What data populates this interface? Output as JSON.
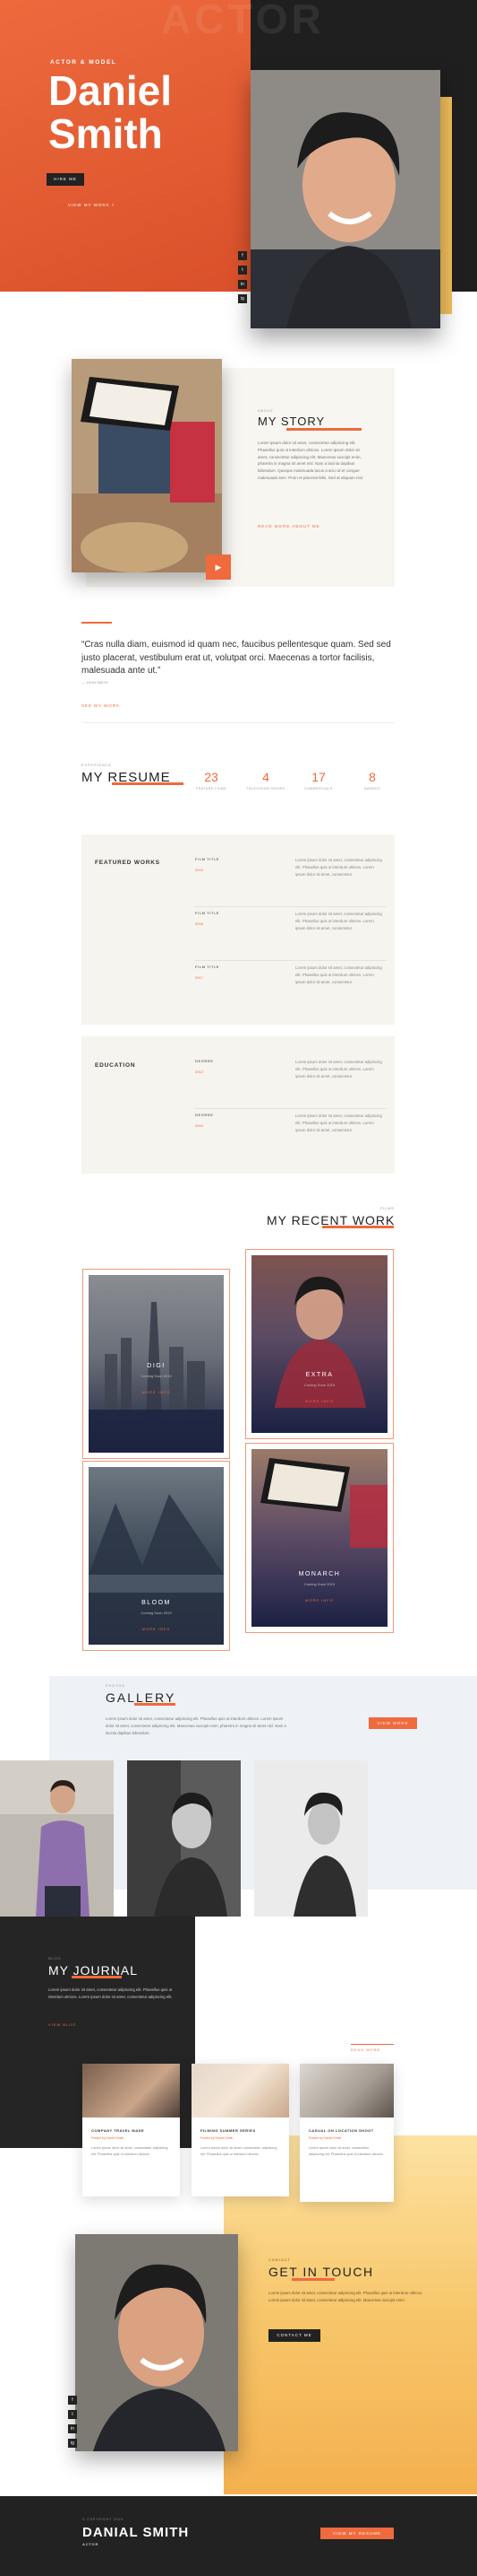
{
  "hero": {
    "bg_word": "ACTOR",
    "kicker": "ACTOR & MODEL",
    "name_line1": "Daniel",
    "name_line2": "Smith",
    "hire_btn": "HIRE ME",
    "about_link": "VIEW MY WORK",
    "socials": [
      "f",
      "t",
      "in",
      "ig"
    ],
    "colors": {
      "orange": "#ef6a3c",
      "dark": "#222222",
      "gold": "#f3c15a"
    }
  },
  "story": {
    "kicker": "ABOUT",
    "title": "MY STORY",
    "body": "Lorem ipsum dolor sit amet, consectetur adipiscing elit. Phasellus quis ut interdum ultrices. Lorem ipsum dolor sit amet, consectetur adipiscing elit. Maecenas suscipit enim, pharetra in magna sit amet nisl. Nam a lacinia dapibus bibendum. Quisque malesuada lacus a arcu id et congue malesuada sem. Proin et placerat felis. Sed at aliquam nisl.",
    "link": "READ MORE ABOUT ME",
    "play_icon": "play-icon"
  },
  "quote": {
    "text": "“Cras nulla diam, euismod id quam nec, faucibus pellentesque quam. Sed sed justo placerat, vestibulum erat ut, volutpat orci. Maecenas a tortor facilisis, malesuada ante ut.”",
    "author": "— JOHN SMITH",
    "link": "SEE MY WORK"
  },
  "resume": {
    "kicker": "EXPERIENCE",
    "title": "MY RESUME",
    "stats": [
      {
        "value": "23",
        "label": "FEATURE FILMS"
      },
      {
        "value": "4",
        "label": "TELEVISION SHOWS"
      },
      {
        "value": "17",
        "label": "COMMERCIALS"
      },
      {
        "value": "8",
        "label": "AWARDS"
      }
    ],
    "works": {
      "heading": "FEATURED WORKS",
      "rows": [
        {
          "title": "FILM TITLE",
          "year": "2019",
          "desc": "Lorem ipsum dolor sit amet, consectetur adipiscing elit. Phasellus quis ut interdum ultrices. Lorem ipsum dolor sit amet, consectetur."
        },
        {
          "title": "FILM TITLE",
          "year": "2018",
          "desc": "Lorem ipsum dolor sit amet, consectetur adipiscing elit. Phasellus quis ut interdum ultrices. Lorem ipsum dolor sit amet, consectetur."
        },
        {
          "title": "FILM TITLE",
          "year": "2017",
          "desc": "Lorem ipsum dolor sit amet, consectetur adipiscing elit. Phasellus quis ut interdum ultrices. Lorem ipsum dolor sit amet, consectetur."
        }
      ]
    },
    "education": {
      "heading": "EDUCATION",
      "rows": [
        {
          "title": "DEGREE",
          "year": "2012",
          "desc": "Lorem ipsum dolor sit amet, consectetur adipiscing elit. Phasellus quis ut interdum ultrices. Lorem ipsum dolor sit amet, consectetur."
        },
        {
          "title": "DEGREE",
          "year": "2010",
          "desc": "Lorem ipsum dolor sit amet, consectetur adipiscing elit. Phasellus quis ut interdum ultrices. Lorem ipsum dolor sit amet, consectetur."
        }
      ]
    }
  },
  "recent_work": {
    "kicker": "FILMS",
    "title": "MY RECENT WORK",
    "cards": [
      {
        "title": "DIGI",
        "meta": "Coming Soon 2019",
        "link": "MORE INFO"
      },
      {
        "title": "EXTRA",
        "meta": "Coming Soon 2019",
        "link": "MORE INFO"
      },
      {
        "title": "BLOOM",
        "meta": "Coming Soon 2019",
        "link": "MORE INFO"
      },
      {
        "title": "MONARCH",
        "meta": "Coming Soon 2019",
        "link": "MORE INFO"
      }
    ]
  },
  "gallery": {
    "kicker": "PHOTOS",
    "title": "GALLERY",
    "body": "Lorem ipsum dolor sit amet, consectetur adipiscing elit. Phasellus quis ut interdum ultrices. Lorem ipsum dolor sit amet, consectetur adipiscing elit. Maecenas suscipit enim, pharetra in magna sit amet nisl. Nam a lacinia dapibus bibendum.",
    "button": "VIEW MORE"
  },
  "journal": {
    "kicker": "BLOG",
    "title": "MY JOURNAL",
    "body": "Lorem ipsum dolor sit amet, consectetur adipiscing elit. Phasellus quis ut interdum ultrices. Lorem ipsum dolor sit amet, consectetur adipiscing elit.",
    "link": "VIEW BLOG",
    "more_link": "READ MORE",
    "posts": [
      {
        "title": "COMPANY TRAVEL MADE",
        "meta": "Posted by Daniel Smith",
        "body": "Lorem ipsum dolor sit amet, consectetur adipiscing elit. Phasellus quis ut interdum ultrices."
      },
      {
        "title": "FILMING SUMMER SERIES",
        "meta": "Posted by Daniel Smith",
        "body": "Lorem ipsum dolor sit amet, consectetur adipiscing elit. Phasellus quis ut interdum ultrices."
      },
      {
        "title": "CASUAL ON LOCATION SHOOT",
        "meta": "Posted by Daniel Smith",
        "body": "Lorem ipsum dolor sit amet, consectetur adipiscing elit. Phasellus quis ut interdum ultrices."
      }
    ]
  },
  "contact": {
    "kicker": "CONTACT",
    "title": "GET IN TOUCH",
    "body": "Lorem ipsum dolor sit amet, consectetur adipiscing elit. Phasellus quis ut interdum ultrices. Lorem ipsum dolor sit amet, consectetur adipiscing elit. Maecenas suscipit enim.",
    "button": "CONTACT ME"
  },
  "footer": {
    "kicker": "© COPYRIGHT 2019",
    "name": "DANIAL SMITH",
    "sub": "ACTOR",
    "button": "VIEW MY RESUME"
  }
}
